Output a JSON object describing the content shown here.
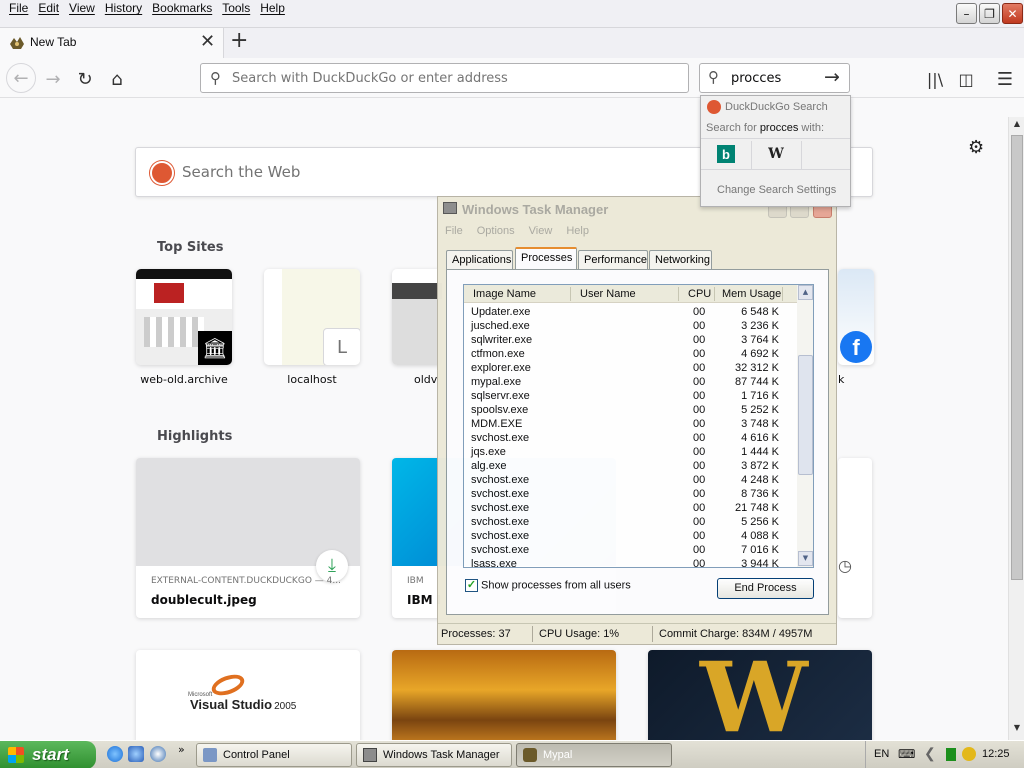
{
  "browser": {
    "menu": [
      "File",
      "Edit",
      "View",
      "History",
      "Bookmarks",
      "Tools",
      "Help"
    ],
    "tab_title": "New Tab",
    "url_placeholder": "Search with DuckDuckGo or enter address",
    "search_value": "procces",
    "search_popup": {
      "engine_header": "DuckDuckGo Search",
      "for_prefix": "Search for ",
      "query": "procces",
      "for_suffix": " with:",
      "bing_glyph": "b",
      "wiki_glyph": "W",
      "settings": "Change Search Settings"
    }
  },
  "newtab": {
    "search_placeholder": "Search the Web",
    "top_sites_title": "Top Sites",
    "top_sites": [
      {
        "label": "web-old.archive"
      },
      {
        "label": "localhost",
        "letter": "L"
      },
      {
        "label": "oldv"
      },
      {
        "label": "k"
      }
    ],
    "highlights_title": "Highlights",
    "highlights": [
      {
        "source": "EXTERNAL-CONTENT.DUCKDUCKGO — 4...",
        "title": "doublecult.jpeg"
      },
      {
        "source": "IBM",
        "title": "IBM I"
      }
    ],
    "visual_studio": {
      "brand": "Microsoft",
      "name": "Visual Studio",
      "year": "2005"
    }
  },
  "task_manager": {
    "title": "Windows Task Manager",
    "menu": [
      "File",
      "Options",
      "View",
      "Help"
    ],
    "tabs": [
      "Applications",
      "Processes",
      "Performance",
      "Networking"
    ],
    "active_tab": "Processes",
    "columns": {
      "image": "Image Name",
      "user": "User Name",
      "cpu": "CPU",
      "mem": "Mem Usage"
    },
    "processes": [
      {
        "name": "Updater.exe",
        "cpu": "00",
        "mem": "6 548 K"
      },
      {
        "name": "jusched.exe",
        "cpu": "00",
        "mem": "3 236 K"
      },
      {
        "name": "sqlwriter.exe",
        "cpu": "00",
        "mem": "3 764 K"
      },
      {
        "name": "ctfmon.exe",
        "cpu": "00",
        "mem": "4 692 K"
      },
      {
        "name": "explorer.exe",
        "cpu": "00",
        "mem": "32 312 K"
      },
      {
        "name": "mypal.exe",
        "cpu": "00",
        "mem": "87 744 K"
      },
      {
        "name": "sqlservr.exe",
        "cpu": "00",
        "mem": "1 716 K"
      },
      {
        "name": "spoolsv.exe",
        "cpu": "00",
        "mem": "5 252 K"
      },
      {
        "name": "MDM.EXE",
        "cpu": "00",
        "mem": "3 748 K"
      },
      {
        "name": "svchost.exe",
        "cpu": "00",
        "mem": "4 616 K"
      },
      {
        "name": "jqs.exe",
        "cpu": "00",
        "mem": "1 444 K"
      },
      {
        "name": "alg.exe",
        "cpu": "00",
        "mem": "3 872 K"
      },
      {
        "name": "svchost.exe",
        "cpu": "00",
        "mem": "4 248 K"
      },
      {
        "name": "svchost.exe",
        "cpu": "00",
        "mem": "8 736 K"
      },
      {
        "name": "svchost.exe",
        "cpu": "00",
        "mem": "21 748 K"
      },
      {
        "name": "svchost.exe",
        "cpu": "00",
        "mem": "5 256 K"
      },
      {
        "name": "svchost.exe",
        "cpu": "00",
        "mem": "4 088 K"
      },
      {
        "name": "svchost.exe",
        "cpu": "00",
        "mem": "7 016 K"
      },
      {
        "name": "lsass.exe",
        "cpu": "00",
        "mem": "3 944 K"
      }
    ],
    "show_all_label": "Show processes from all users",
    "show_all_checked": true,
    "end_process": "End Process",
    "status": {
      "processes": "Processes: 37",
      "cpu": "CPU Usage: 1%",
      "commit": "Commit Charge: 834M / 4957M"
    }
  },
  "taskbar": {
    "start": "start",
    "tasks": [
      {
        "label": "Control Panel"
      },
      {
        "label": "Windows Task Manager"
      },
      {
        "label": "Mypal"
      }
    ],
    "tray_lang": "EN",
    "clock": "12:25"
  },
  "colors": {
    "ddg": "#de5833",
    "bing": "#008373",
    "start_green": "#3c9a3c",
    "tab_accent": "#e68b2c"
  }
}
